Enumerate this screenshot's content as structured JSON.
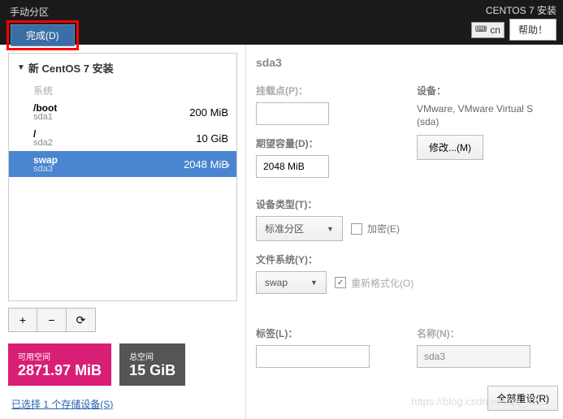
{
  "header": {
    "title": "手动分区",
    "done_label": "完成(D)",
    "install_title": "CENTOS 7 安装",
    "lang": "cn",
    "help_label": "帮助！"
  },
  "tree": {
    "root": "新 CentOS 7 安装",
    "system_label": "系统",
    "items": [
      {
        "name": "/boot",
        "dev": "sda1",
        "size": "200 MiB"
      },
      {
        "name": "/",
        "dev": "sda2",
        "size": "10 GiB"
      },
      {
        "name": "swap",
        "dev": "sda3",
        "size": "2048 MiB"
      }
    ]
  },
  "buttons": {
    "add": "+",
    "remove": "−",
    "reload": "⟳"
  },
  "space": {
    "avail_label": "可用空间",
    "avail_value": "2871.97 MiB",
    "total_label": "总空间",
    "total_value": "15 GiB"
  },
  "select_link": "已选择 1 个存储设备(S)",
  "detail": {
    "title": "sda3",
    "labels": {
      "mount": "挂载点(P)：",
      "capacity": "期望容量(D)：",
      "device": "设备：",
      "devtype": "设备类型(T)：",
      "fs": "文件系统(Y)：",
      "label": "标签(L)：",
      "name": "名称(N)：",
      "encrypt": "加密(E)",
      "reformat": "重新格式化(O)"
    },
    "values": {
      "mount": "",
      "capacity": "2048 MiB",
      "device_text": "VMware, VMware Virtual S (sda)",
      "devtype": "标准分区",
      "fs": "swap",
      "label_val": "",
      "name_val": "sda3"
    },
    "modify_btn": "修改...(M)"
  },
  "reset_btn": "全部重设(R)",
  "watermark": "https://blog.csdn.net/qq_42..."
}
